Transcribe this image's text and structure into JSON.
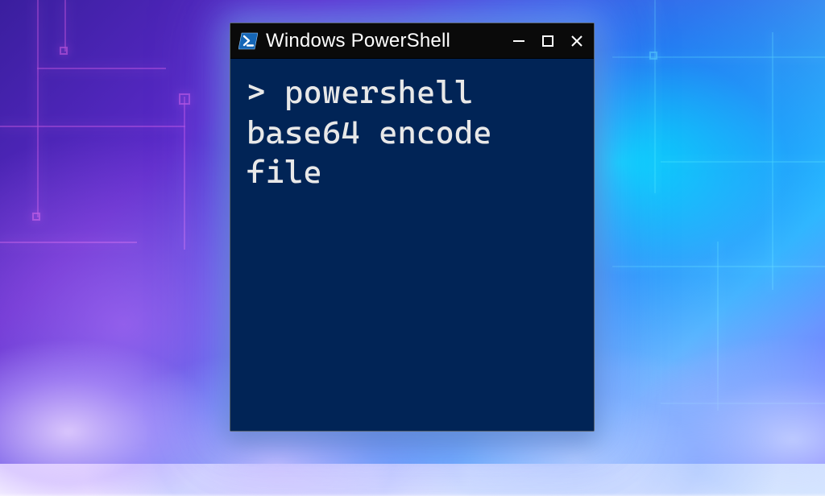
{
  "window": {
    "title": "Windows PowerShell"
  },
  "terminal": {
    "prompt": ">",
    "command_text": "powershell base64 encode file"
  },
  "icons": {
    "app": "powershell-icon",
    "minimize": "minimize-icon",
    "maximize": "maximize-icon",
    "close": "close-icon"
  },
  "colors": {
    "term_bg": "#012456",
    "titlebar_bg": "#0a0a0a",
    "text": "#e8e8e8"
  }
}
